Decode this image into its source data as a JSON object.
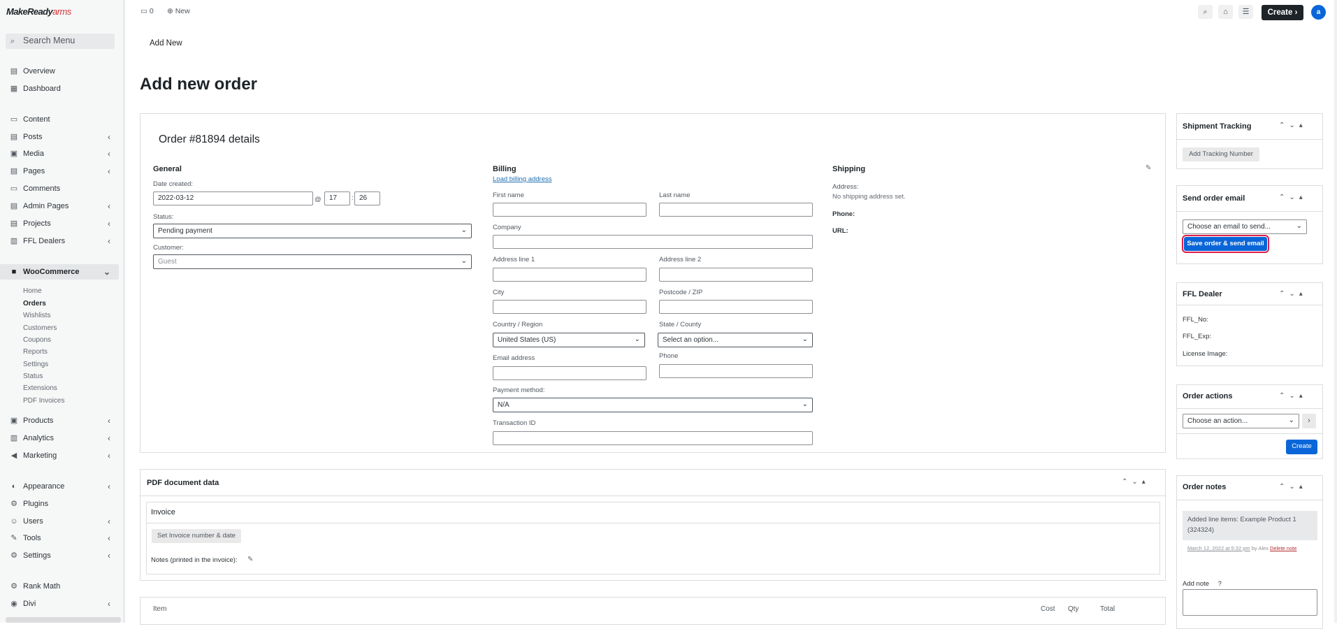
{
  "brand": {
    "logo_main": "MakeReady",
    "logo_accent": "arms"
  },
  "sidebar": {
    "search_label": "Search Menu",
    "menu": {
      "overview": "Overview",
      "dashboard": "Dashboard",
      "content": "Content",
      "posts": "Posts",
      "media": "Media",
      "pages": "Pages",
      "comments": "Comments",
      "admin_pages": "Admin Pages",
      "projects": "Projects",
      "ffl_dealers": "FFL Dealers",
      "woocommerce": "WooCommerce",
      "products": "Products",
      "analytics": "Analytics",
      "marketing": "Marketing",
      "appearance": "Appearance",
      "plugins": "Plugins",
      "users": "Users",
      "tools": "Tools",
      "settings": "Settings",
      "rank_math": "Rank Math",
      "divi": "Divi"
    },
    "woo_sub": {
      "home": "Home",
      "orders": "Orders",
      "wishlists": "Wishlists",
      "customers": "Customers",
      "coupons": "Coupons",
      "reports": "Reports",
      "settings": "Settings",
      "status": "Status",
      "extensions": "Extensions",
      "pdf_invoices": "PDF Invoices"
    }
  },
  "topbar": {
    "comments_count": "0",
    "new_label": "New",
    "create_label": "Create",
    "avatar_initial": "a"
  },
  "header": {
    "add_new_tab": "Add New",
    "page_title": "Add new order"
  },
  "order": {
    "title": "Order #81894 details",
    "general": {
      "heading": "General",
      "date_label": "Date created:",
      "date": "2022-03-12",
      "at": "@",
      "hour": "17",
      "minute": "26",
      "status_label": "Status:",
      "status": "Pending payment",
      "customer_label": "Customer:",
      "customer": "Guest"
    },
    "billing": {
      "heading": "Billing",
      "load_link": "Load billing address",
      "first_name": "First name",
      "last_name": "Last name",
      "company": "Company",
      "address1": "Address line 1",
      "address2": "Address line 2",
      "city": "City",
      "postcode": "Postcode / ZIP",
      "country_label": "Country / Region",
      "country": "United States (US)",
      "state_label": "State / County",
      "state": "Select an option...",
      "email": "Email address",
      "phone": "Phone",
      "payment_label": "Payment method:",
      "payment": "N/A",
      "transaction": "Transaction ID"
    },
    "shipping": {
      "heading": "Shipping",
      "address_label": "Address:",
      "address_value": "No shipping address set.",
      "phone_label": "Phone:",
      "url_label": "URL:"
    }
  },
  "pdf": {
    "heading": "PDF document data",
    "invoice_label": "Invoice",
    "set_button": "Set Invoice number & date",
    "notes_label": "Notes (printed in the invoice):"
  },
  "items": {
    "item": "Item",
    "cost": "Cost",
    "qty": "Qty",
    "total": "Total"
  },
  "right": {
    "tracking": {
      "title": "Shipment Tracking",
      "button": "Add Tracking Number"
    },
    "email": {
      "title": "Send order email",
      "select": "Choose an email to send...",
      "button": "Save order & send email"
    },
    "ffl": {
      "title": "FFL Dealer",
      "no": "FFL_No:",
      "exp": "FFL_Exp:",
      "license": "License Image:"
    },
    "actions": {
      "title": "Order actions",
      "select": "Choose an action...",
      "create": "Create"
    },
    "notes": {
      "title": "Order notes",
      "note_text": "Added line items: Example Product 1 (324324)",
      "note_date": "March 12, 2022 at 5:32 pm",
      "note_by": "by Alex",
      "delete": "Delete note",
      "add_label": "Add note"
    }
  }
}
